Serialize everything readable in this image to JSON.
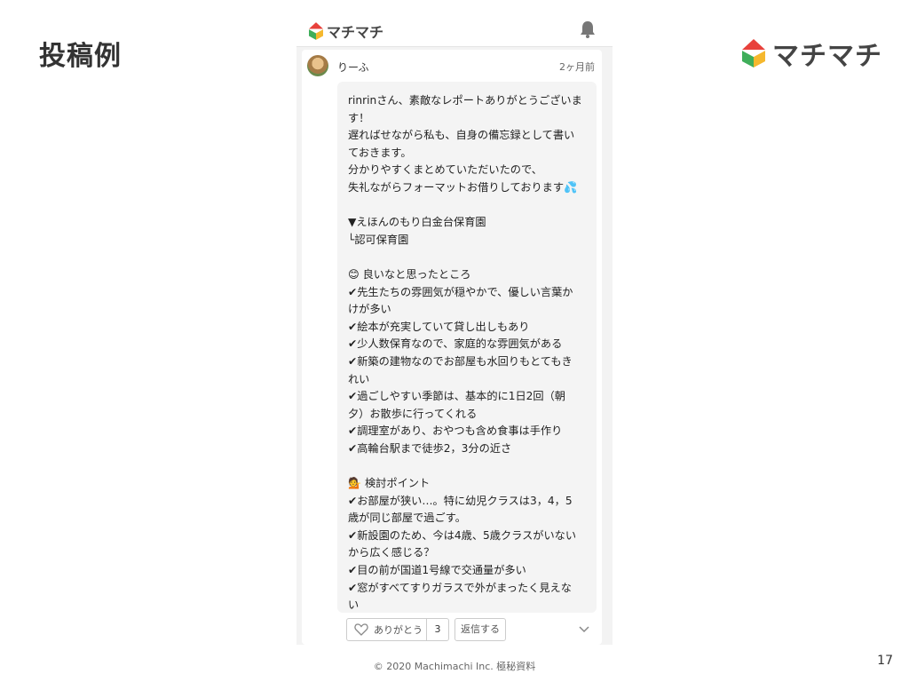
{
  "slide": {
    "title": "投稿例",
    "brand": "マチマチ",
    "footer": "© 2020 Machimachi Inc. 極秘資料",
    "page_number": "17"
  },
  "app": {
    "logo_text": "マチマチ",
    "icons": [
      "machimachi-logo-icon",
      "bell-icon"
    ]
  },
  "post": {
    "username": "りーふ",
    "time": "2ヶ月前",
    "paragraphs": [
      "rinrinさん、素敵なレポートありがとうございま\nす！\n遅ればせながら私も、自身の備忘録として書い\nておきます。\n分かりやすくまとめていただいたので、\n失礼ながらフォーマットお借りしております💦",
      "▼えほんのもり白金台保育園\n└認可保育園",
      "😊 良いなと思ったところ\n✔先生たちの雰囲気が穏やかで、優しい言葉か\nけが多い\n✔絵本が充実していて貸し出しもあり\n✔少人数保育なので、家庭的な雰囲気がある\n✔新築の建物なのでお部屋も水回りもとてもき\nれい\n✔過ごしやすい季節は、基本的に1日2回（朝\n夕）お散歩に行ってくれる\n✔調理室があり、おやつも含め食事は手作り\n✔高輪台駅まで徒歩2，3分の近さ",
      "💁 検討ポイント\n✔お部屋が狭い…。特に幼児クラスは3，4，5\n歳が同じ部屋で過ごす。\n✔新設園のため、今は4歳、5歳クラスがいない\nから広く感じる？\n✔目の前が国道1号線で交通量が多い\n✔窓がすべてすりガラスで外がまったく見えな\nい"
    ],
    "thanks_label": "ありがとう",
    "thanks_count": "3",
    "reply_label": "返信する"
  },
  "colors": {
    "logo_red": "#e8413b",
    "logo_green": "#3fae5a",
    "logo_yellow": "#f5b82e"
  }
}
